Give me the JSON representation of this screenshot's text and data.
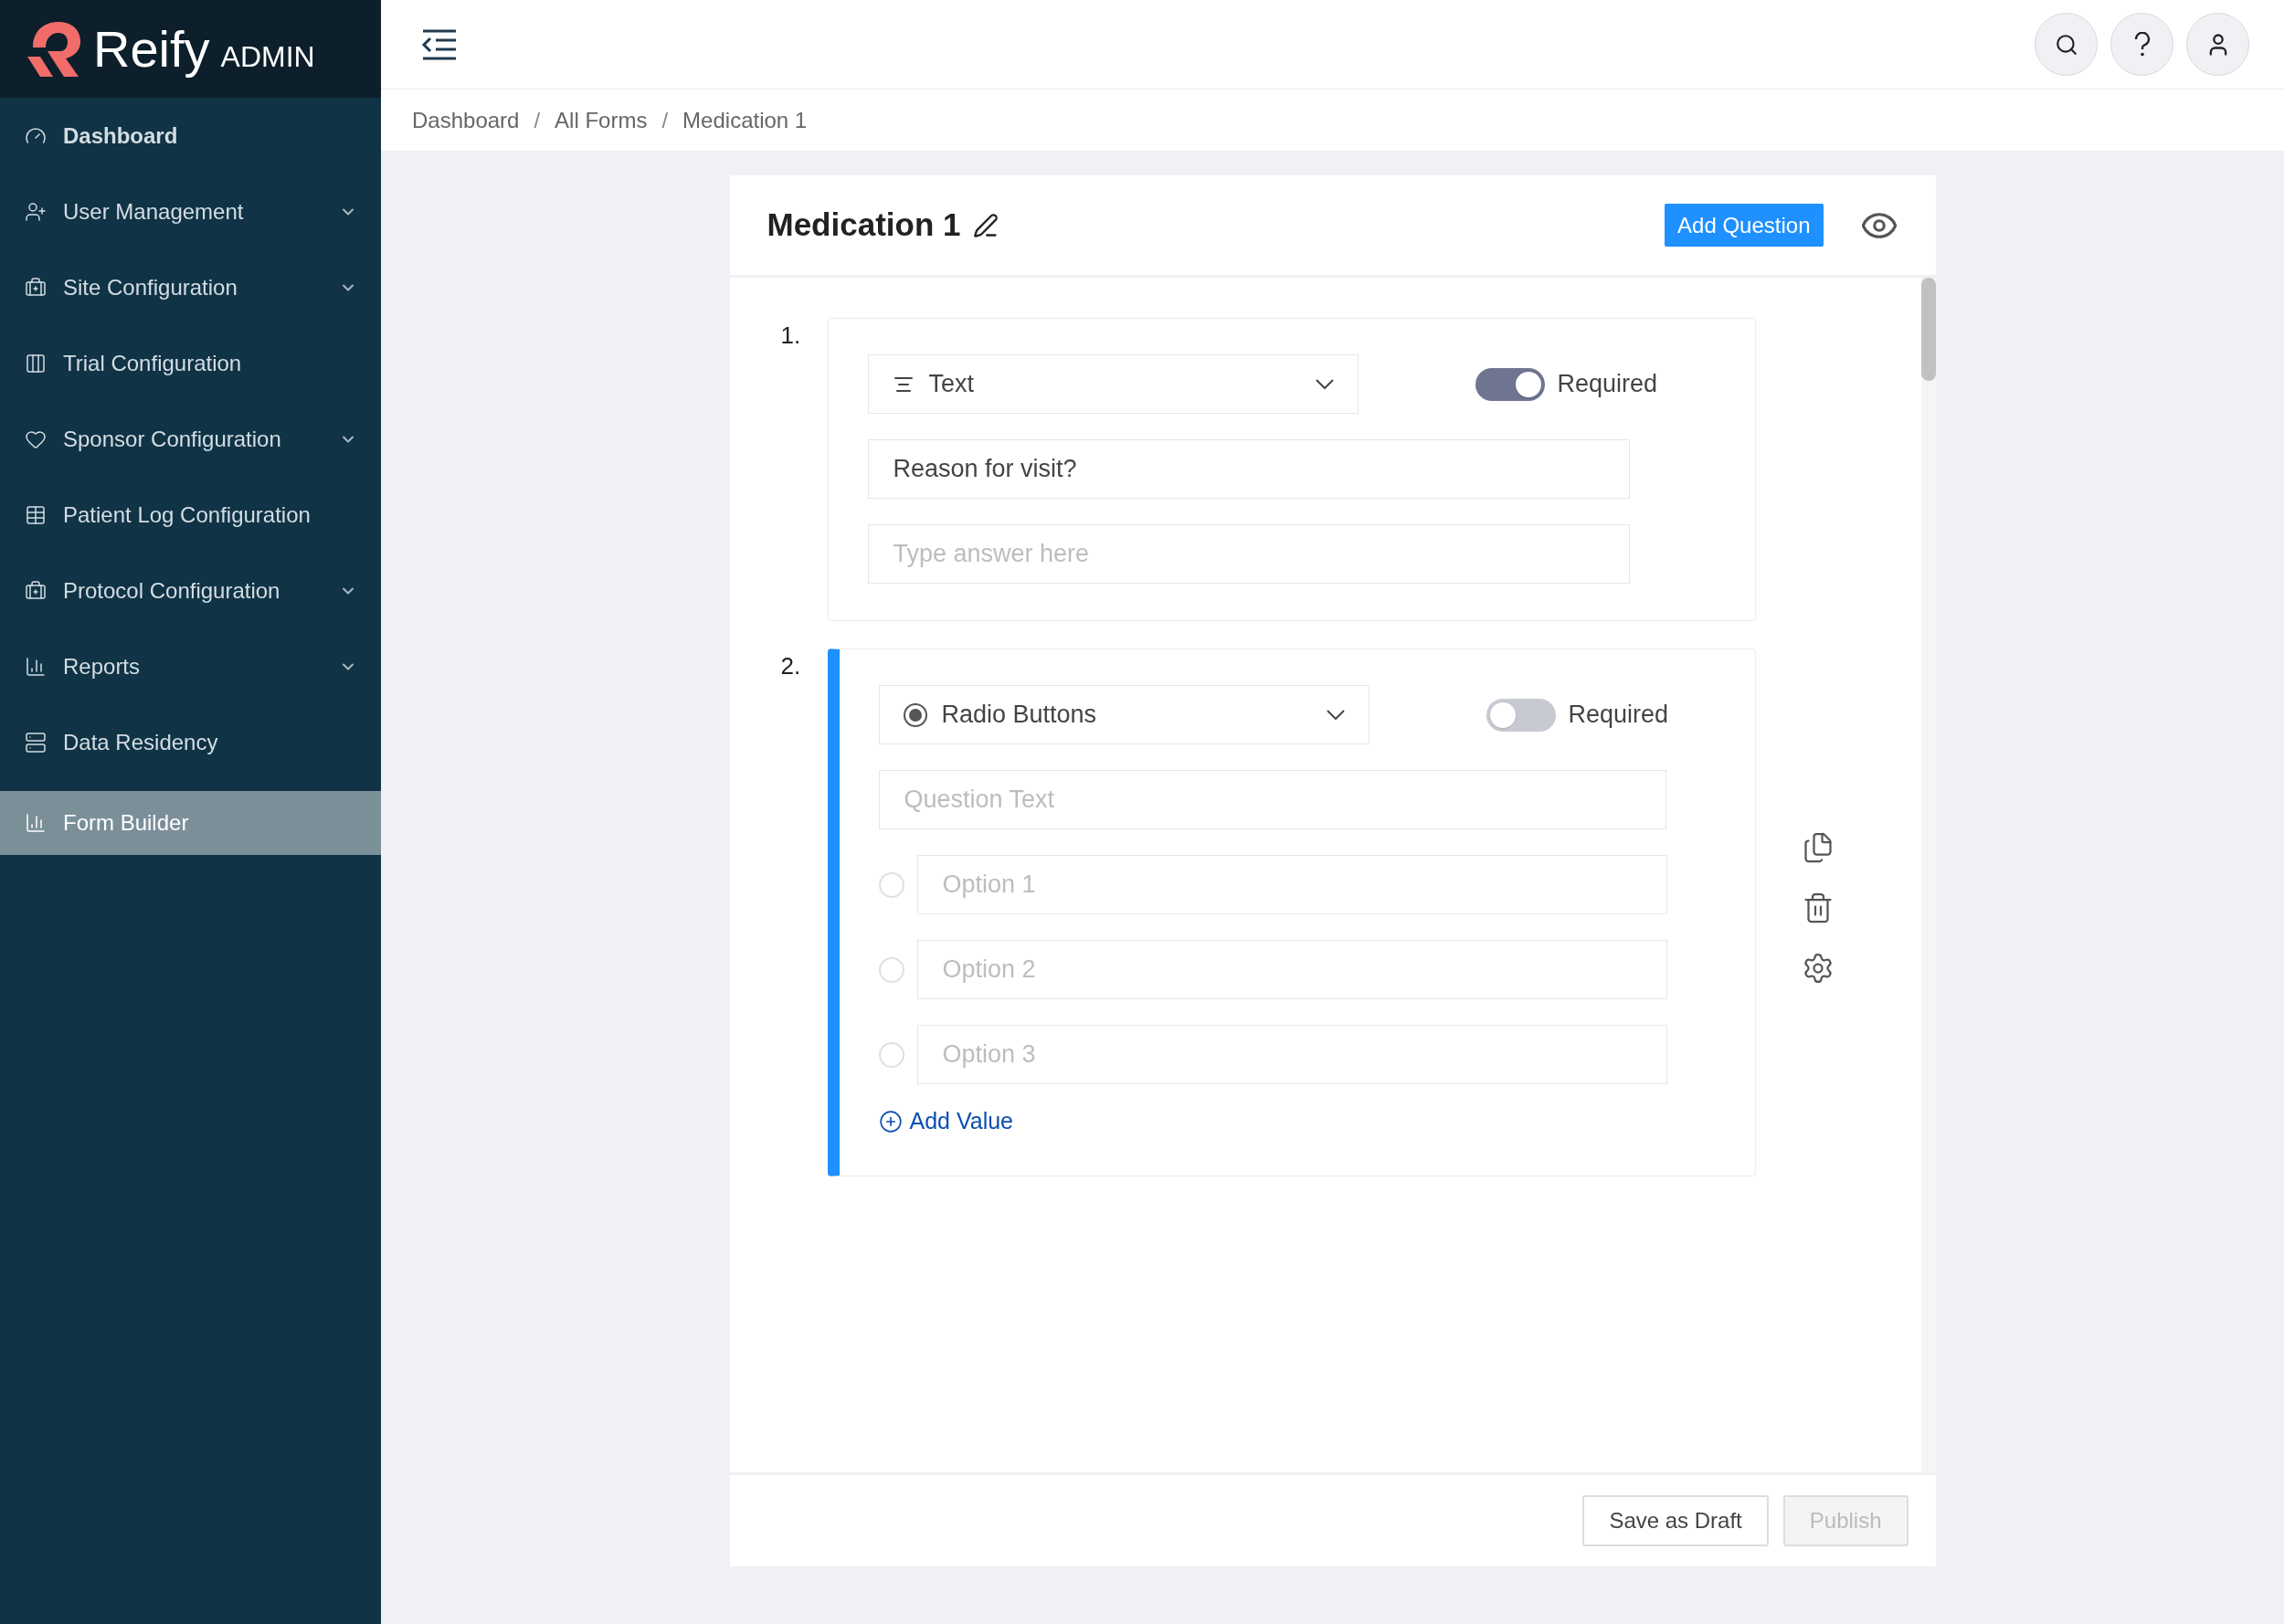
{
  "brand": {
    "name": "Reify",
    "suffix": "ADMIN"
  },
  "sidebar": {
    "items": [
      {
        "label": "Dashboard",
        "expandable": false,
        "selected": false
      },
      {
        "label": "User Management",
        "expandable": true,
        "selected": false
      },
      {
        "label": "Site Configuration",
        "expandable": true,
        "selected": false
      },
      {
        "label": "Trial Configuration",
        "expandable": false,
        "selected": false
      },
      {
        "label": "Sponsor Configuration",
        "expandable": true,
        "selected": false
      },
      {
        "label": "Patient Log Configuration",
        "expandable": false,
        "selected": false
      },
      {
        "label": "Protocol Configuration",
        "expandable": true,
        "selected": false
      },
      {
        "label": "Reports",
        "expandable": true,
        "selected": false
      },
      {
        "label": "Data Residency",
        "expandable": false,
        "selected": false
      },
      {
        "label": "Form Builder",
        "expandable": false,
        "selected": true
      }
    ]
  },
  "breadcrumb": {
    "separator": "/",
    "items": [
      "Dashboard",
      "All Forms",
      "Medication 1"
    ]
  },
  "form": {
    "title": "Medication 1",
    "add_button": "Add Question",
    "questions": [
      {
        "kind": "text",
        "number": "1.",
        "type_label": "Text",
        "required": true,
        "required_label": "Required",
        "active": false,
        "question": {
          "value": "Reason for visit?"
        },
        "answer": {
          "placeholder": "Type answer here"
        }
      },
      {
        "kind": "radio",
        "number": "2.",
        "type_label": "Radio Buttons",
        "required": false,
        "required_label": "Required",
        "active": true,
        "question": {
          "placeholder": "Question Text"
        },
        "options": [
          {
            "placeholder": "Option 1"
          },
          {
            "placeholder": "Option 2"
          },
          {
            "placeholder": "Option 3"
          }
        ],
        "add_value": "Add Value"
      }
    ]
  },
  "footer": {
    "save": "Save as Draft",
    "publish": {
      "label": "Publish",
      "disabled": true
    }
  }
}
